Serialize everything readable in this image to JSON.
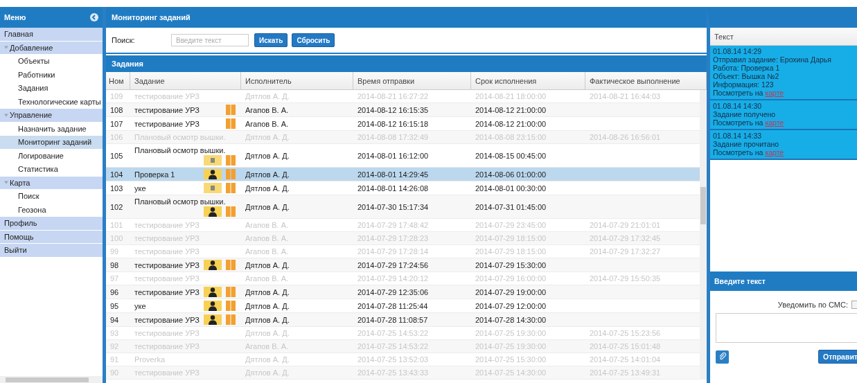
{
  "sidebar": {
    "title": "Меню",
    "items": [
      {
        "label": "Главная",
        "selected": false
      },
      {
        "label": "Добавление",
        "selected": false,
        "expanded": true,
        "children": [
          {
            "label": "Объекты",
            "selected": false
          },
          {
            "label": "Работники",
            "selected": false
          },
          {
            "label": "Задания",
            "selected": false
          },
          {
            "label": "Технологические карты",
            "selected": false
          }
        ]
      },
      {
        "label": "Управление",
        "selected": false,
        "expanded": true,
        "children": [
          {
            "label": "Назначить задание",
            "selected": false
          },
          {
            "label": "Мониторинг заданий",
            "selected": true
          },
          {
            "label": "Логирование",
            "selected": false
          },
          {
            "label": "Статистика",
            "selected": false
          }
        ]
      },
      {
        "label": "Карта",
        "selected": false,
        "expanded": true,
        "children": [
          {
            "label": "Поиск",
            "selected": false
          },
          {
            "label": "Геозона",
            "selected": false
          }
        ]
      },
      {
        "label": "Профиль",
        "selected": false
      },
      {
        "label": "Помощь",
        "selected": false
      },
      {
        "label": "Выйти",
        "selected": false
      }
    ]
  },
  "main": {
    "title": "Мониторинг заданий",
    "search": {
      "label": "Поиск:",
      "placeholder": "Введите текст",
      "buttons": [
        "Искать",
        "Сбросить"
      ]
    }
  },
  "tasks": {
    "title": "Задания",
    "columns": [
      "Ном",
      "Задание",
      "Исполнитель",
      "Время отправки",
      "Срок исполнения",
      "Фактическое выполнение"
    ],
    "rows": [
      {
        "number": "109",
        "task": "тестирование УРЗ",
        "icons": [],
        "executor": "Дятлов А. Д.",
        "sent": "2014-08-21 16:27:22",
        "deadline": "2014-08-21 18:00:00",
        "actual": "2014-08-21 16:44:03",
        "completed": true,
        "selected": false
      },
      {
        "number": "108",
        "task": "тестирование УРЗ",
        "icons": [
          {
            "kind": "book"
          }
        ],
        "executor": "Агапов В. А.",
        "sent": "2014-08-12 16:15:35",
        "deadline": "2014-08-12 21:00:00",
        "actual": "",
        "completed": false,
        "selected": false
      },
      {
        "number": "107",
        "task": "тестирование УРЗ",
        "icons": [
          {
            "kind": "book"
          }
        ],
        "executor": "Агапов В. А.",
        "sent": "2014-08-12 16:15:18",
        "deadline": "2014-08-12 21:00:00",
        "actual": "",
        "completed": false,
        "selected": false
      },
      {
        "number": "106",
        "task": "Плановый осмотр вышки.",
        "icons": [],
        "executor": "Дятлов А. Д.",
        "sent": "2014-08-08 17:32:49",
        "deadline": "2014-08-08 23:15:00",
        "actual": "2014-08-26 16:56:01",
        "completed": true,
        "selected": false
      },
      {
        "number": "105",
        "task": "Плановый осмотр вышки.",
        "icons": [
          {
            "kind": "doc"
          },
          {
            "kind": "book"
          }
        ],
        "executor": "Дятлов А. Д.",
        "sent": "2014-08-01 16:12:00",
        "deadline": "2014-08-15 00:45:00",
        "actual": "",
        "completed": false,
        "selected": false
      },
      {
        "number": "104",
        "task": "Проверка 1",
        "icons": [
          {
            "kind": "person"
          },
          {
            "kind": "book"
          }
        ],
        "executor": "Дятлов А. Д.",
        "sent": "2014-08-01 14:29:45",
        "deadline": "2014-08-06 01:00:00",
        "actual": "",
        "completed": false,
        "selected": true
      },
      {
        "number": "103",
        "task": "уке",
        "icons": [
          {
            "kind": "doc"
          },
          {
            "kind": "book"
          }
        ],
        "executor": "Дятлов А. Д.",
        "sent": "2014-08-01 14:26:08",
        "deadline": "2014-08-01 00:30:00",
        "actual": "",
        "completed": false,
        "selected": false
      },
      {
        "number": "102",
        "task": "Плановый осмотр вышки.",
        "icons": [
          {
            "kind": "person"
          },
          {
            "kind": "book"
          }
        ],
        "executor": "Дятлов А. Д.",
        "sent": "2014-07-30 15:17:34",
        "deadline": "2014-07-31 01:45:00",
        "actual": "",
        "completed": false,
        "selected": false
      },
      {
        "number": "101",
        "task": "тестирование УРЗ",
        "icons": [],
        "executor": "Агапов В. А.",
        "sent": "2014-07-29 17:48:42",
        "deadline": "2014-07-29 23:45:00",
        "actual": "2014-07-29 21:01:01",
        "completed": true,
        "selected": false
      },
      {
        "number": "100",
        "task": "тестирование УРЗ",
        "icons": [],
        "executor": "Агапов В. А.",
        "sent": "2014-07-29 17:28:23",
        "deadline": "2014-07-29 18:15:00",
        "actual": "2014-07-29 17:32:45",
        "completed": true,
        "selected": false
      },
      {
        "number": "99",
        "task": "тестирование УРЗ",
        "icons": [],
        "executor": "Агапов В. А.",
        "sent": "2014-07-29 17:28:14",
        "deadline": "2014-07-29 18:15:00",
        "actual": "2014-07-29 17:32:27",
        "completed": true,
        "selected": false
      },
      {
        "number": "98",
        "task": "тестирование УРЗ",
        "icons": [
          {
            "kind": "person"
          },
          {
            "kind": "book"
          }
        ],
        "executor": "Дятлов А. Д.",
        "sent": "2014-07-29 17:24:56",
        "deadline": "2014-07-29 15:30:00",
        "actual": "",
        "completed": false,
        "selected": false
      },
      {
        "number": "97",
        "task": "тестирование УРЗ",
        "icons": [],
        "executor": "Агапов В. А.",
        "sent": "2014-07-29 14:20:12",
        "deadline": "2014-07-29 16:00:00",
        "actual": "2014-07-29 15:50:35",
        "completed": true,
        "selected": false
      },
      {
        "number": "96",
        "task": "тестирование УРЗ",
        "icons": [
          {
            "kind": "person"
          },
          {
            "kind": "book"
          }
        ],
        "executor": "Дятлов А. Д.",
        "sent": "2014-07-29 12:35:06",
        "deadline": "2014-07-29 19:00:00",
        "actual": "",
        "completed": false,
        "selected": false
      },
      {
        "number": "95",
        "task": "уке",
        "icons": [
          {
            "kind": "person"
          },
          {
            "kind": "book"
          }
        ],
        "executor": "Дятлов А. Д.",
        "sent": "2014-07-28 11:25:44",
        "deadline": "2014-07-29 12:00:00",
        "actual": "",
        "completed": false,
        "selected": false
      },
      {
        "number": "94",
        "task": "тестирование УРЗ",
        "icons": [
          {
            "kind": "person"
          },
          {
            "kind": "book"
          }
        ],
        "executor": "Дятлов А. Д.",
        "sent": "2014-07-28 11:08:57",
        "deadline": "2014-07-28 14:30:00",
        "actual": "",
        "completed": false,
        "selected": false
      },
      {
        "number": "93",
        "task": "тестирование УРЗ",
        "icons": [],
        "executor": "Дятлов А. Д.",
        "sent": "2014-07-25 14:53:22",
        "deadline": "2014-07-25 19:30:00",
        "actual": "2014-07-25 15:23:56",
        "completed": true,
        "selected": false
      },
      {
        "number": "92",
        "task": "тестирование УРЗ",
        "icons": [],
        "executor": "Агапов В. А.",
        "sent": "2014-07-25 14:53:22",
        "deadline": "2014-07-25 19:30:00",
        "actual": "2014-07-25 15:01:48",
        "completed": true,
        "selected": false
      },
      {
        "number": "91",
        "task": "Proverka",
        "icons": [],
        "executor": "Дятлов А. Д.",
        "sent": "2014-07-25 13:52:03",
        "deadline": "2014-07-25 15:30:00",
        "actual": "2014-07-25 14:01:04",
        "completed": true,
        "selected": false
      },
      {
        "number": "90",
        "task": "тестирование УРЗ",
        "icons": [],
        "executor": "Дятлов А. Д.",
        "sent": "2014-07-25 13:43:33",
        "deadline": "2014-07-25 14:30:00",
        "actual": "2014-07-25 13:49:31",
        "completed": true,
        "selected": false
      }
    ]
  },
  "messages": {
    "column": "Текст",
    "items": [
      {
        "time": "01.08.14 14:29",
        "lines": [
          "Отправил задание: Ерохина Дарья",
          "Работа: Проверка 1",
          "Объект: Вышка №2",
          "Информация: 123"
        ],
        "link_text": "Посмотреть на",
        "link": "карте"
      },
      {
        "time": "01.08.14 14:30",
        "lines": [
          "Задание получено"
        ],
        "link_text": "Посмотреть на",
        "link": "карте"
      },
      {
        "time": "01.08.14 14:33",
        "lines": [
          "Задание прочитано"
        ],
        "link_text": "Посмотреть на",
        "link": "карте"
      }
    ]
  },
  "compose": {
    "title": "Введите текст",
    "sms_label": "Уведомить по СМС:",
    "sms_checked": false,
    "send_button": "Отправит"
  }
}
